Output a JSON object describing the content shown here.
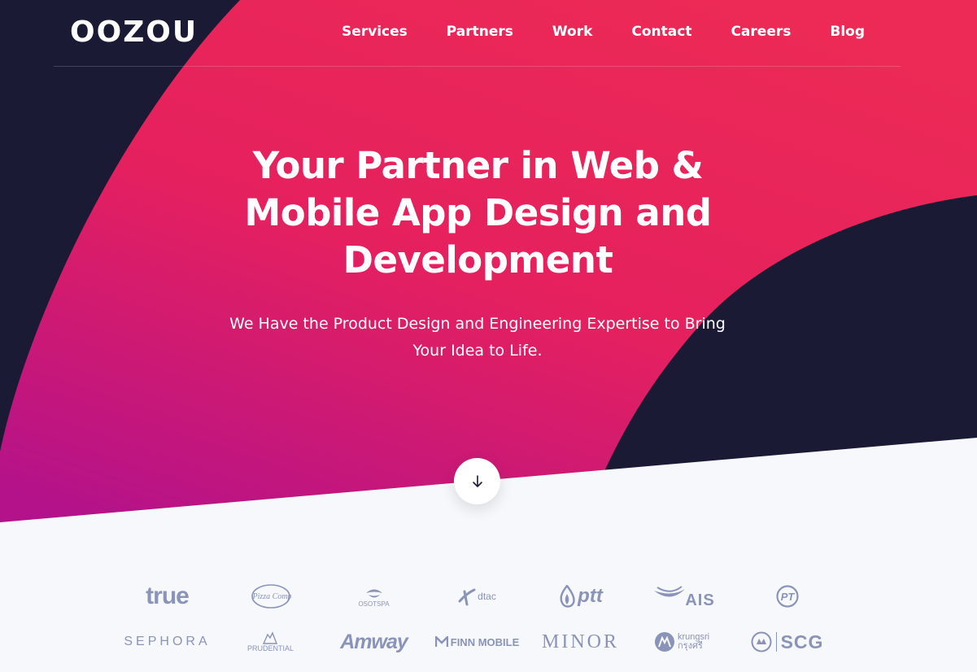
{
  "brand": {
    "logo_text": "OOZOU"
  },
  "nav": {
    "items": [
      {
        "label": "Services"
      },
      {
        "label": "Partners"
      },
      {
        "label": "Work"
      },
      {
        "label": "Contact"
      },
      {
        "label": "Careers"
      },
      {
        "label": "Blog"
      }
    ]
  },
  "hero": {
    "title": "Your Partner in Web & Mobile App Design and Development",
    "subtitle": "We Have the Product Design and Engineering Expertise to Bring Your Idea to Life.",
    "scroll_icon": "arrow-down-icon"
  },
  "clients": {
    "row1": [
      "true",
      "The Pizza Company",
      "OSOTSPA",
      "dtac",
      "ptt",
      "AIS",
      "PT"
    ],
    "row2": [
      "SEPHORA",
      "PRUDENTIAL",
      "Amway",
      "FINN MOBILE",
      "MINOR",
      "krungsri กรุงศรี",
      "SCG"
    ]
  },
  "colors": {
    "dark_navy": "#1b1a35",
    "hero_pink": "#e8215a",
    "hero_magenta": "#b8127f",
    "light_bg": "#f7f8fc",
    "logo_gray": "#8a93b8"
  }
}
